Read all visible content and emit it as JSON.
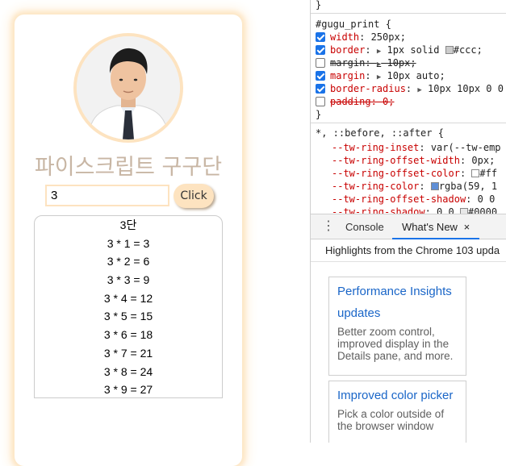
{
  "app": {
    "title": "파이스크립트 구구단",
    "input_value": "3",
    "button_label": "Click",
    "result_lines": [
      "3단",
      "3 * 1 = 3",
      "3 * 2 = 6",
      "3 * 3 = 9",
      "3 * 4 = 12",
      "3 * 5 = 15",
      "3 * 6 = 18",
      "3 * 7 = 21",
      "3 * 8 = 24",
      "3 * 9 = 27"
    ]
  },
  "devtools": {
    "rule_close_top": "}",
    "selector": "#gugu_print {",
    "declarations": [
      {
        "name": "width",
        "value": "250px;",
        "checked": true,
        "struck": false,
        "expand": false,
        "swatch": ""
      },
      {
        "name": "border",
        "value": "1px solid",
        "value2": "#ccc;",
        "checked": true,
        "struck": false,
        "expand": true,
        "swatch": "#cccccc"
      },
      {
        "name": "margin",
        "value": "10px;",
        "checked": false,
        "struck": true,
        "expand": true,
        "swatch": ""
      },
      {
        "name": "margin",
        "value": "10px auto;",
        "checked": true,
        "struck": false,
        "expand": true,
        "swatch": ""
      },
      {
        "name": "border-radius",
        "value": "10px 10px 0 0",
        "checked": true,
        "struck": false,
        "expand": true,
        "swatch": ""
      },
      {
        "name": "padding",
        "value": "0;",
        "checked": false,
        "struck": true,
        "expand": false,
        "swatch": ""
      }
    ],
    "rule_close": "}",
    "universal_selector": "*, ::before, ::after {",
    "vars": [
      {
        "name": "--tw-ring-inset",
        "value": "var(--tw-emp"
      },
      {
        "name": "--tw-ring-offset-width",
        "value": "0px;"
      },
      {
        "name": "--tw-ring-offset-color",
        "value": "#ff",
        "swatch": "#ffffff"
      },
      {
        "name": "--tw-ring-color",
        "value": "rgba(59, 1",
        "swatch": "#5f8fd6"
      },
      {
        "name": "--tw-ring-offset-shadow",
        "value": "0 0"
      },
      {
        "name": "--tw-ring-shadow",
        "value": "0 0",
        "value2": "#0000",
        "swatch": "#e8e8e8"
      }
    ],
    "tabs": {
      "console": "Console",
      "whats_new": "What's New",
      "close": "×"
    },
    "highlights": "Highlights from the Chrome 103 upda",
    "features": [
      {
        "title": "Performance Insights updates",
        "desc": "Better zoom control, improved display in the Details pane, and more."
      },
      {
        "title": "Improved color picker",
        "desc": "Pick a color outside of the browser window"
      }
    ]
  },
  "colors": {
    "accent": "#fde3c0",
    "title": "#c8b6a4",
    "link": "#1a66c8",
    "checkbox": "#1a73e8",
    "property": "#c80000"
  }
}
